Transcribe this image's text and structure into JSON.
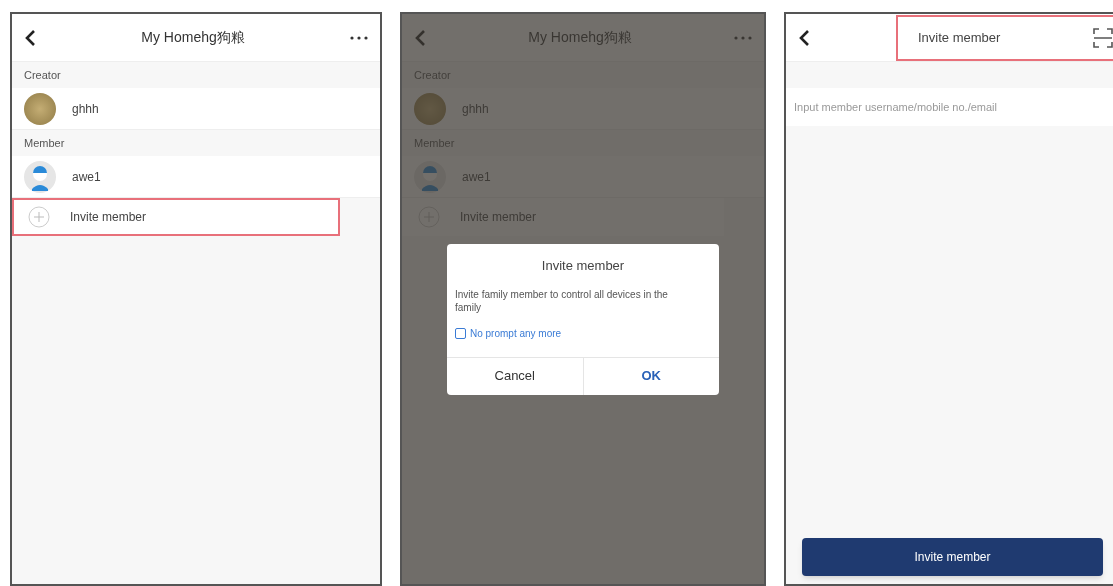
{
  "screens": [
    {
      "kind": "members",
      "title": "My Homehg狗粮",
      "sections": [
        {
          "header": "Creator",
          "members": [
            {
              "name": "ghhh",
              "kind": "photo"
            }
          ]
        },
        {
          "header": "Member",
          "members": [
            {
              "name": "awe1",
              "kind": "user"
            }
          ]
        }
      ],
      "invite": {
        "label": "Invite member",
        "highlighted": true
      }
    },
    {
      "kind": "members",
      "title": "My Homehg狗粮",
      "sections": [
        {
          "header": "Creator",
          "members": [
            {
              "name": "ghhh",
              "kind": "photo"
            }
          ]
        },
        {
          "header": "Member",
          "members": [
            {
              "name": "awe1",
              "kind": "user"
            }
          ]
        }
      ],
      "invite": {
        "label": "Invite member",
        "highlighted": false
      },
      "dialog": {
        "title": "Invite member",
        "message": "Invite family member to control all devices in the family",
        "checkbox": {
          "label": "No prompt any more",
          "checked": false
        },
        "buttons": [
          "Cancel",
          "OK"
        ]
      }
    },
    {
      "kind": "invite",
      "title": "Invite member",
      "highlighted": true,
      "placeholder": "Input member username/mobile no./email",
      "button": "Invite member"
    }
  ]
}
